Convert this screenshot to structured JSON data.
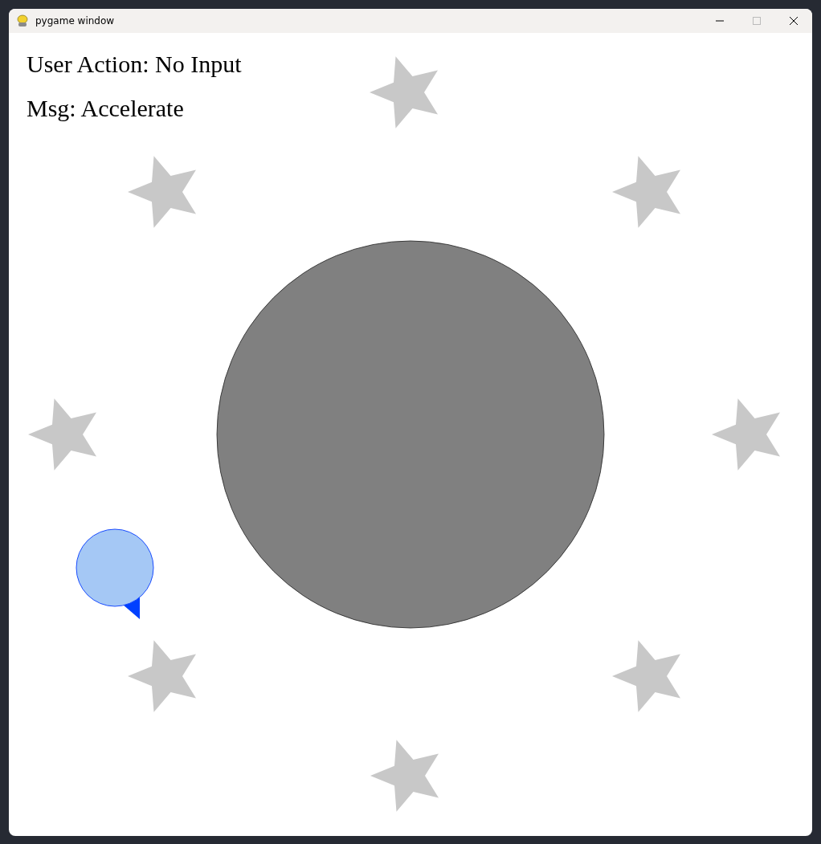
{
  "window": {
    "title": "pygame window"
  },
  "hud": [
    {
      "label": "User Action: No Input"
    },
    {
      "label": "Msg: Accelerate"
    }
  ]
}
